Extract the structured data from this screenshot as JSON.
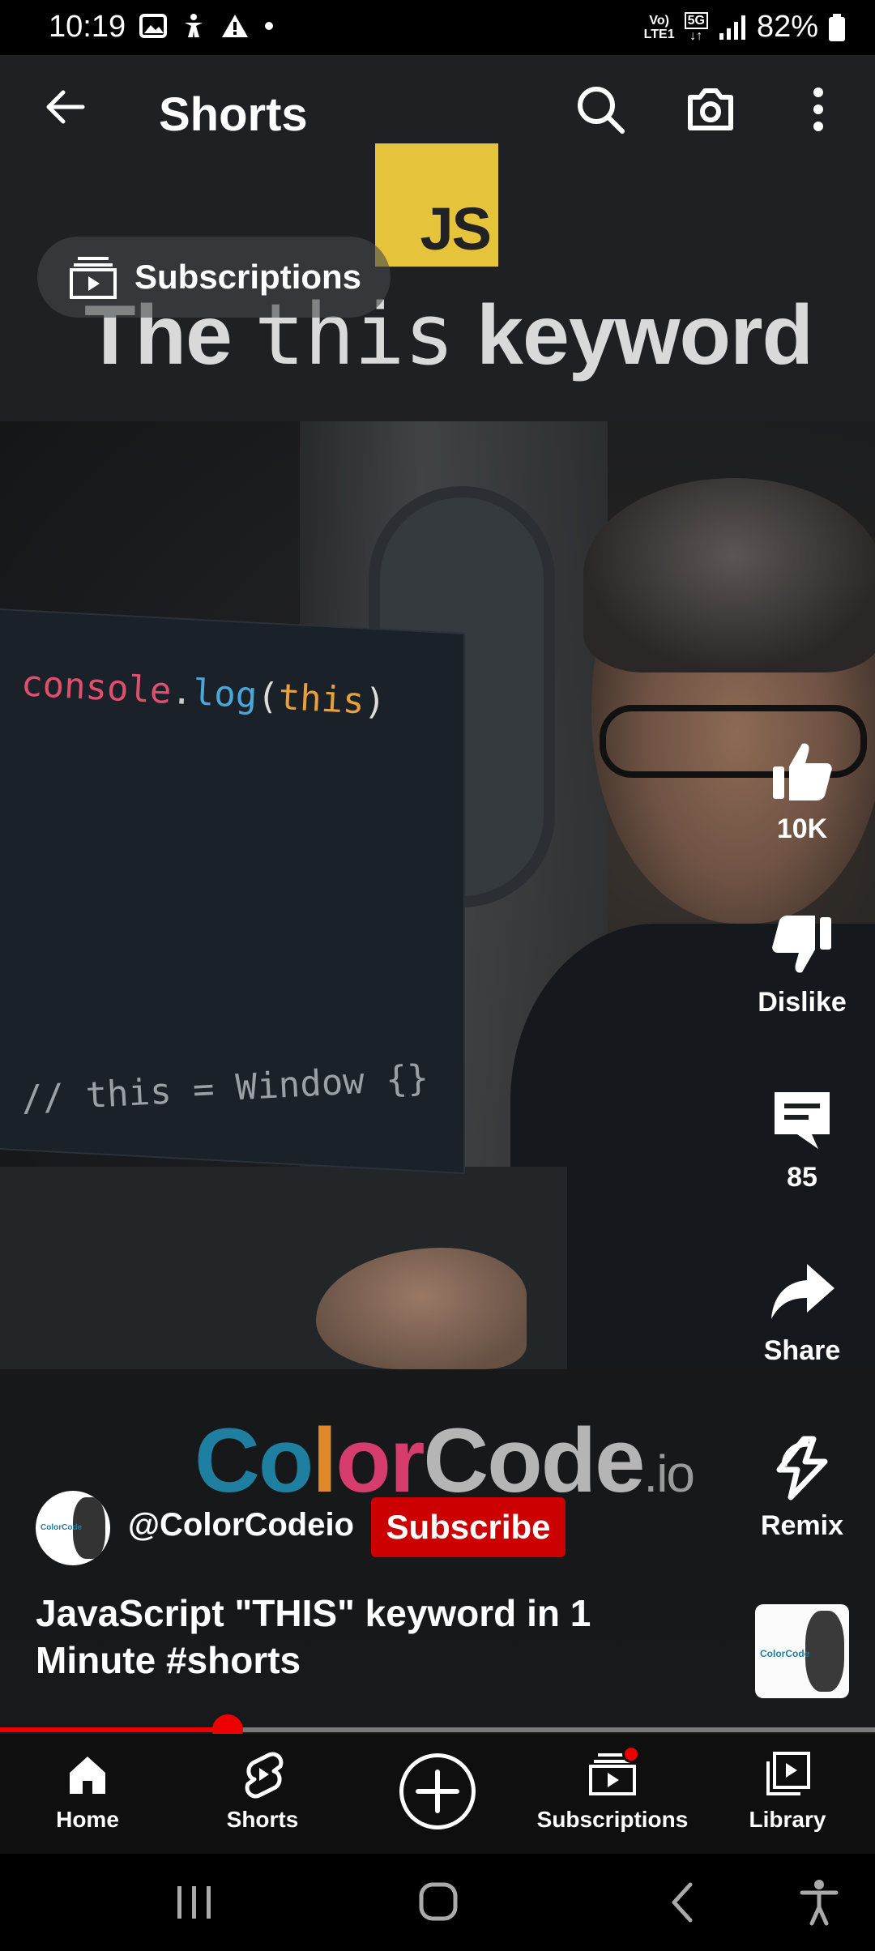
{
  "status_bar": {
    "time": "10:19",
    "network_top": "Vo)",
    "network_bottom": "LTE1",
    "network_gen": "5G",
    "battery": "82%"
  },
  "top_bar": {
    "title": "Shorts",
    "icons": [
      "back-arrow-icon",
      "search-icon",
      "camera-icon",
      "more-vert-icon"
    ]
  },
  "subscriptions_chip": {
    "label": "Subscriptions"
  },
  "video_overlay": {
    "badge": "JS",
    "title_pre": "The ",
    "title_code": "this",
    "title_post": " keyword",
    "code_line1_a": "console",
    "code_line1_b": ".",
    "code_line1_c": "log",
    "code_line1_d": "(",
    "code_line1_e": "this",
    "code_line1_f": ")",
    "code_line2": "// this = Window {}",
    "brand_c1": "Co",
    "brand_c2": "l",
    "brand_c3": "or",
    "brand_c4": "Code",
    "brand_io": ".io"
  },
  "rail": {
    "like_count": "10K",
    "dislike_label": "Dislike",
    "comments_count": "85",
    "share_label": "Share",
    "remix_label": "Remix"
  },
  "channel": {
    "handle": "@ColorCodeio",
    "subscribe_label": "Subscribe",
    "avatar_text": "ColorCode"
  },
  "video": {
    "title": "JavaScript \"THIS\" keyword in 1 Minute #shorts",
    "sound_thumb_text": "ColorCode",
    "progress_fraction": 0.26
  },
  "bottom_nav": {
    "items": [
      {
        "label": "Home",
        "icon": "home-icon"
      },
      {
        "label": "Shorts",
        "icon": "shorts-icon"
      },
      {
        "label": "",
        "icon": "create-plus-icon"
      },
      {
        "label": "Subscriptions",
        "icon": "subscriptions-icon"
      },
      {
        "label": "Library",
        "icon": "library-icon"
      }
    ]
  },
  "colors": {
    "accent_red": "#cc0000",
    "progress_red": "#ee0000",
    "js_yellow": "#e5c33a",
    "brand_teal": "#1f7fa0",
    "brand_orange": "#e0892a",
    "brand_pink": "#d63d6e"
  }
}
